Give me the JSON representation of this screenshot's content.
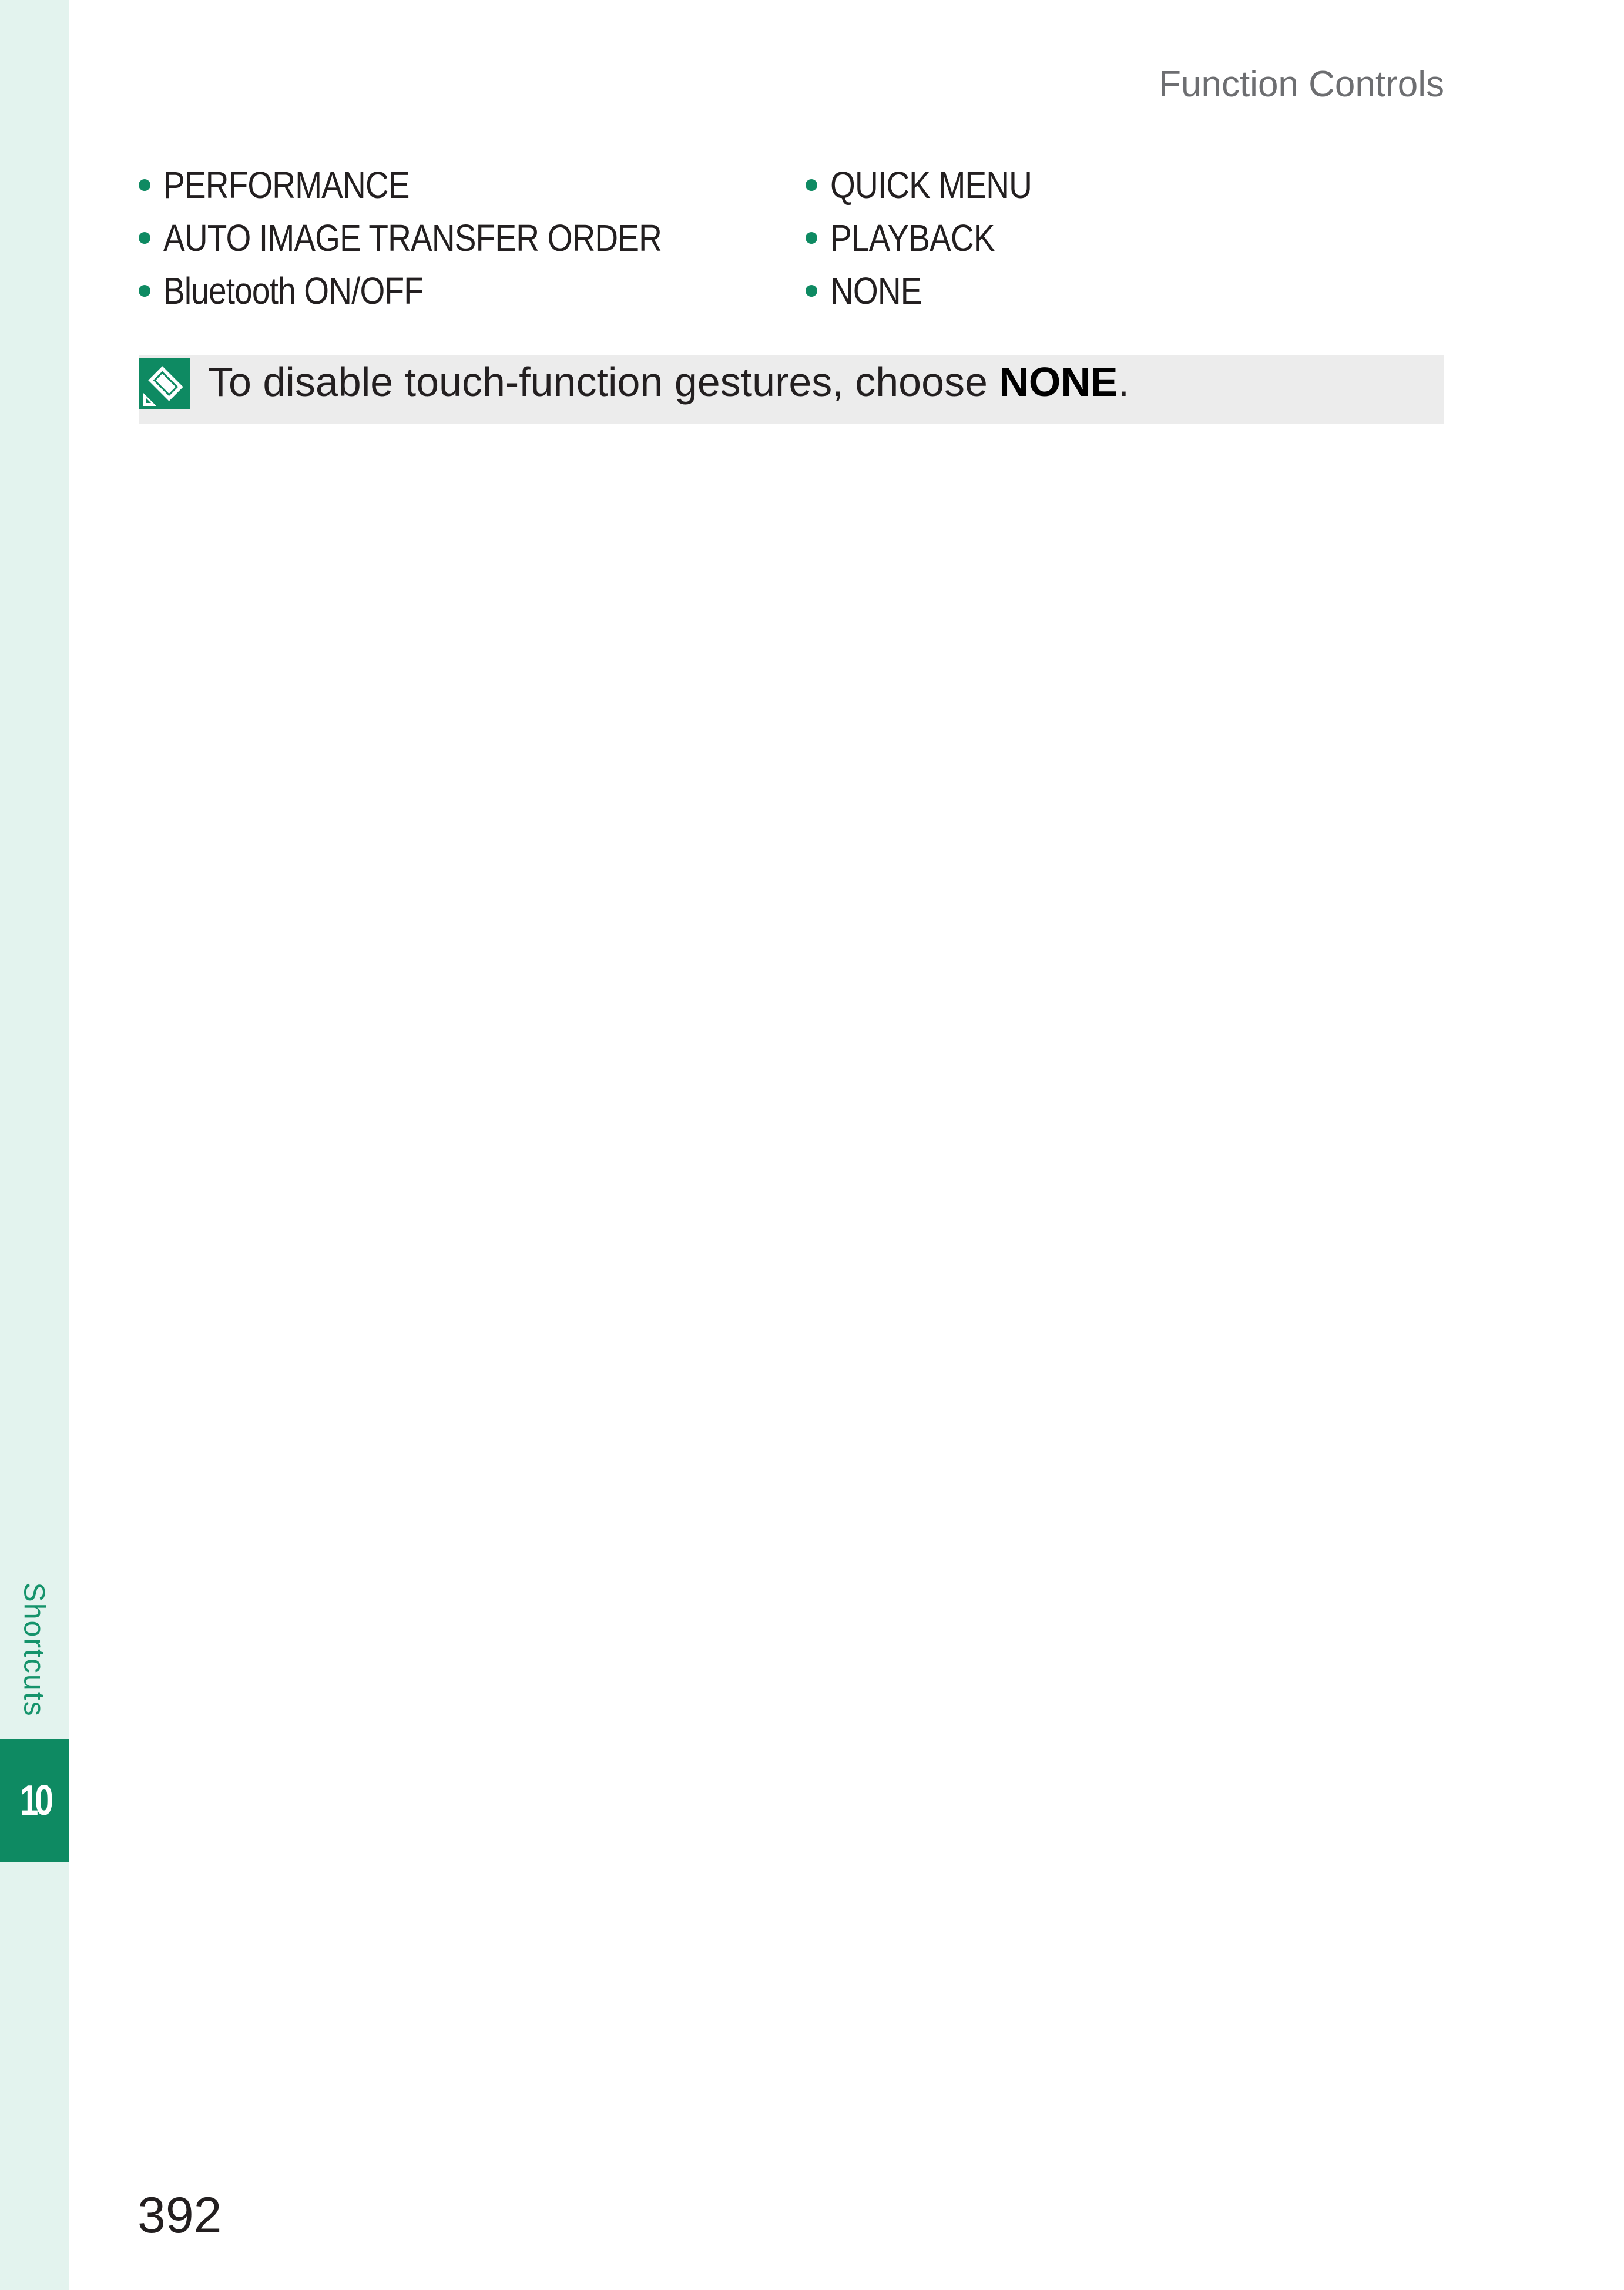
{
  "header": {
    "running_title": "Function Controls"
  },
  "sidebar": {
    "chapter_title": "Shortcuts",
    "chapter_number": "10"
  },
  "options": {
    "column_left": [
      "PERFORMANCE",
      "AUTO IMAGE TRANSFER ORDER",
      "Bluetooth ON/OFF"
    ],
    "column_right": [
      "QUICK MENU",
      "PLAYBACK",
      "NONE"
    ]
  },
  "note": {
    "icon": "note-pencil-icon",
    "text_before": "To disable touch-function gestures, choose ",
    "emphasis": "NONE",
    "text_after": "."
  },
  "footer": {
    "page_number": "392"
  },
  "colors": {
    "accent_green": "#0e8a62",
    "sidebar_tint": "#e3f3ee",
    "note_background": "#ececec"
  }
}
